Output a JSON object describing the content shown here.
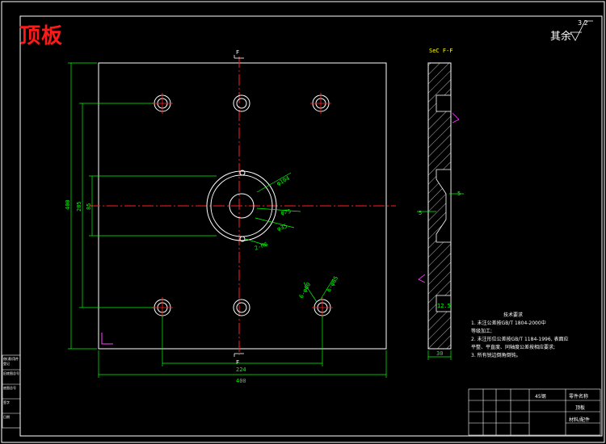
{
  "title": "顶板",
  "roughness": {
    "label": "其余",
    "value": "3.2"
  },
  "section_label": "SeC F-F",
  "section_letter": "F",
  "dimensions": {
    "width_total": "400",
    "hole_spacing": "224",
    "height_total": "400",
    "height_mid": "285",
    "height_small": "85",
    "dia_outer": "φ104",
    "dia_mid": "φ75",
    "dia_inner": "φ35",
    "counterbore": "2-M6",
    "hole_callout_a": "6-φ60",
    "hole_callout_b": "6-φ85",
    "side_dim_1": "5",
    "side_dim_2": "5",
    "side_dim_3": "12.5",
    "thickness": "30"
  },
  "notes": {
    "heading": "技术要求",
    "lines": [
      "1. 未注公差按GB/T 1804-2000中",
      "   等级加工;",
      "2. 未注形位公差按GB/T 1184-1996, 表面应",
      "   平整、平直度、同轴度公差按相应要求;",
      "3. 所有锐边倒角倒钝。"
    ]
  },
  "title_block": {
    "material": "45钢",
    "part_name_label": "零件名称",
    "part_name": "顶板",
    "drawing_no_label": "材料/配件"
  },
  "left_strip": [
    "借(通)用件登记",
    "旧底图总号",
    "底图总号",
    "签字",
    "日期"
  ]
}
